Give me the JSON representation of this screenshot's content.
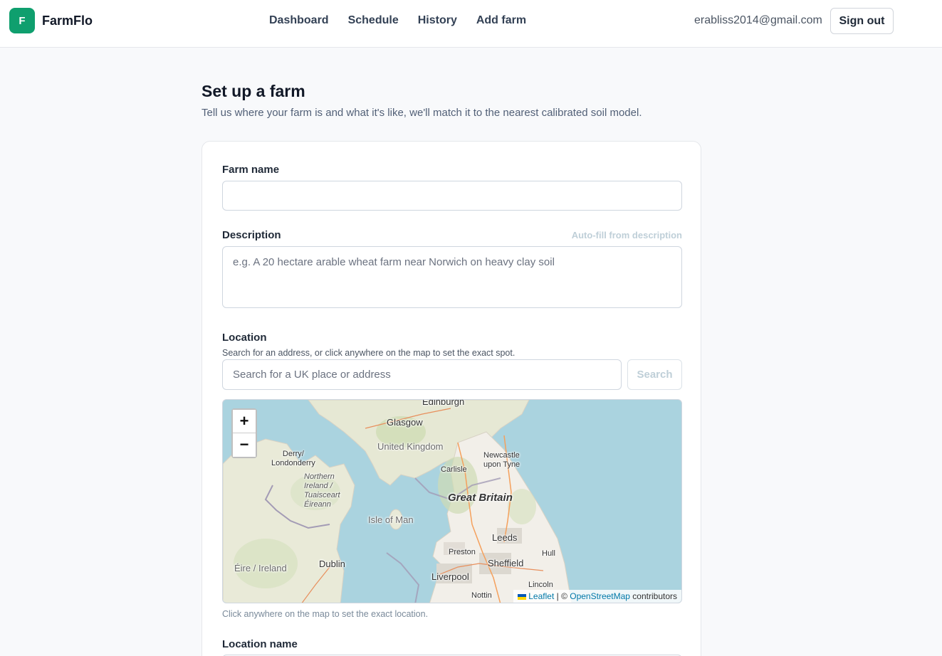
{
  "header": {
    "brand_letter": "F",
    "brand_name": "FarmFlo",
    "nav": [
      "Dashboard",
      "Schedule",
      "History",
      "Add farm"
    ],
    "user_email": "erabliss2014@gmail.com",
    "sign_out": "Sign out"
  },
  "page": {
    "title": "Set up a farm",
    "subtitle": "Tell us where your farm is and what it's like, we'll match it to the nearest calibrated soil model."
  },
  "form": {
    "farm_name": {
      "label": "Farm name",
      "value": ""
    },
    "description": {
      "label": "Description",
      "autofill": "Auto-fill from description",
      "placeholder": "e.g. A 20 hectare arable wheat farm near Norwich on heavy clay soil"
    },
    "location": {
      "label": "Location",
      "help": "Search for an address, or click anywhere on the map to set the exact spot.",
      "search_placeholder": "Search for a UK place or address",
      "search_button": "Search"
    },
    "map": {
      "zoom_in": "+",
      "zoom_out": "−",
      "labels": {
        "edinburgh": "Edinburgh",
        "glasgow": "Glasgow",
        "united_kingdom": "United Kingdom",
        "derry": "Derry/\nLondonderry",
        "northern_ireland": "Northern\nIreland /\nTuaisceart\nÉireann",
        "newcastle": "Newcastle\nupon Tyne",
        "carlisle": "Carlisle",
        "great_britain": "Great Britain",
        "isle_of_man": "Isle of Man",
        "leeds": "Leeds",
        "preston": "Preston",
        "hull": "Hull",
        "sheffield": "Sheffield",
        "liverpool": "Liverpool",
        "dublin": "Dublin",
        "eire": "Éire / Ireland",
        "lincoln": "Lincoln",
        "nottingham": "Nottin"
      },
      "attribution": {
        "leaflet": "Leaflet",
        "separator": " | © ",
        "osm": "OpenStreetMap",
        "contributors": " contributors"
      },
      "click_help": "Click anywhere on the map to set the exact location."
    },
    "location_name": {
      "label": "Location name"
    }
  },
  "colors": {
    "brand": "#0f9f6e",
    "sea": "#aad3df",
    "land": "#f2efe9",
    "muted_button_text": "#bfcfd8"
  }
}
